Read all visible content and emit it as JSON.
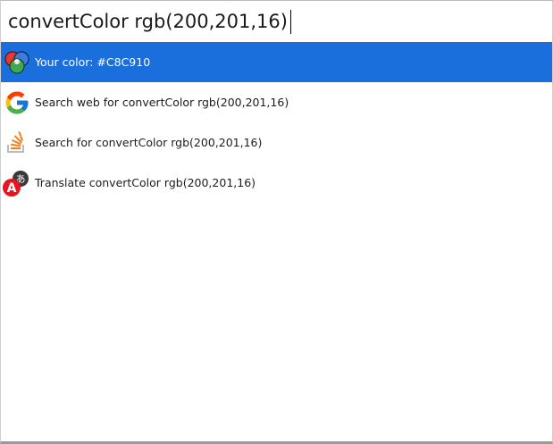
{
  "search": {
    "query": "convertColor rgb(200,201,16)"
  },
  "results": [
    {
      "label": "Your color: #C8C910",
      "icon": "color-circles-icon",
      "selected": true
    },
    {
      "label": "Search web for convertColor rgb(200,201,16)",
      "icon": "google-icon",
      "selected": false
    },
    {
      "label": "Search for convertColor rgb(200,201,16)",
      "icon": "stackoverflow-icon",
      "selected": false
    },
    {
      "label": "Translate convertColor rgb(200,201,16)",
      "icon": "translate-icon",
      "selected": false
    }
  ],
  "colors": {
    "selection": "#1A6FDC",
    "detected_color": "#C8C910"
  }
}
